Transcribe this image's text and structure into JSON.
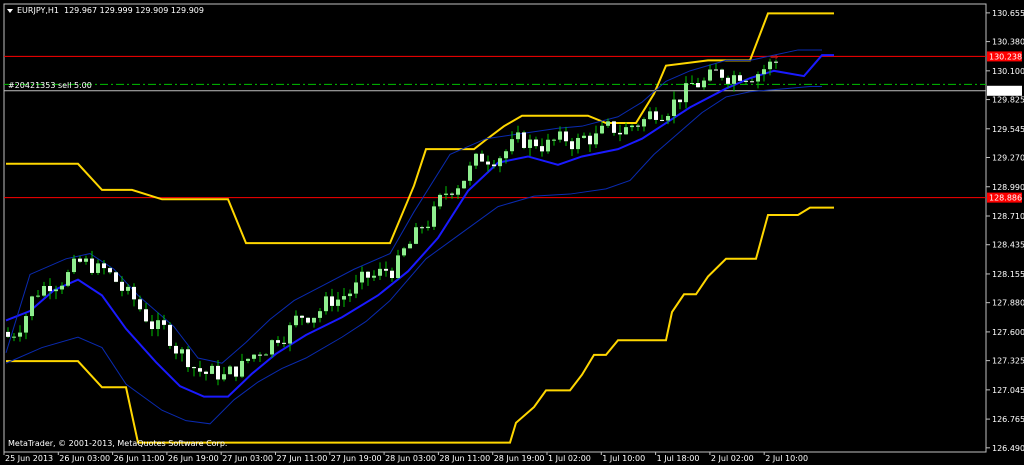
{
  "header": {
    "menu_icon": "triangle-down-icon",
    "symbol": "EURJPY,H1",
    "ohlc": "129.967 129.999 129.909 129.909"
  },
  "order_label": "#20421353 sell 5.00",
  "copyright": "MetaTrader, © 2001-2013, MetaQuotes Software Corp.",
  "price_tags": {
    "current": "129.909",
    "upper_line": "130.238",
    "lower_line": "128.886"
  },
  "colors": {
    "background": "#000000",
    "frame": "#c0c0c0",
    "bull_candle": "#90ee90",
    "bear_candle": "#ffffff",
    "wick": "#00c000",
    "outer_channel": "#ffd700",
    "mid_line": "#1a1aff",
    "inner_channel": "#0a2ab0",
    "horizontal_lines": "#ff0000",
    "order_line": "#00c000",
    "bid_line": "#c0c0c0"
  },
  "chart_data": {
    "type": "line",
    "symbol": "EURJPY",
    "timeframe": "H1",
    "ylim": [
      126.45,
      130.74
    ],
    "y_ticks": [
      "130.655",
      "130.380",
      "130.100",
      "129.825",
      "129.545",
      "129.270",
      "128.990",
      "128.710",
      "128.435",
      "128.155",
      "127.880",
      "127.600",
      "127.325",
      "127.045",
      "126.765",
      "126.490"
    ],
    "x_ticks": [
      "25 Jun 2013",
      "26 Jun 03:00",
      "26 Jun 11:00",
      "26 Jun 19:00",
      "27 Jun 03:00",
      "27 Jun 11:00",
      "27 Jun 19:00",
      "28 Jun 03:00",
      "28 Jun 11:00",
      "28 Jun 19:00",
      "1 Jul 02:00",
      "1 Jul 10:00",
      "1 Jul 18:00",
      "2 Jul 02:00",
      "2 Jul 10:00"
    ],
    "bar_count": 129,
    "horizontal_lines": [
      {
        "price": 130.238,
        "role": "upper red line"
      },
      {
        "price": 128.886,
        "role": "lower red line"
      },
      {
        "price": 129.97,
        "role": "order line"
      },
      {
        "price": 129.909,
        "role": "bid line"
      }
    ],
    "series": [
      {
        "role": "outer_channel_upper",
        "points": [
          [
            0,
            129.21
          ],
          [
            12,
            129.21
          ],
          [
            16,
            128.96
          ],
          [
            21,
            128.96
          ],
          [
            26,
            128.87
          ],
          [
            37,
            128.87
          ],
          [
            40,
            128.45
          ],
          [
            64,
            128.45
          ],
          [
            68,
            129.0
          ],
          [
            70,
            129.35
          ],
          [
            78,
            129.35
          ],
          [
            80,
            129.44
          ],
          [
            83,
            129.57
          ],
          [
            86,
            129.67
          ],
          [
            97,
            129.67
          ],
          [
            100,
            129.6
          ],
          [
            105,
            129.6
          ],
          [
            108,
            129.88
          ],
          [
            110,
            130.15
          ],
          [
            117,
            130.2
          ],
          [
            124,
            130.2
          ],
          [
            127,
            130.65
          ],
          [
            138,
            130.65
          ]
        ]
      },
      {
        "role": "outer_channel_lower",
        "points": [
          [
            0,
            127.32
          ],
          [
            12,
            127.32
          ],
          [
            16,
            127.07
          ],
          [
            20,
            127.07
          ],
          [
            22,
            126.54
          ],
          [
            84,
            126.54
          ],
          [
            85,
            126.73
          ],
          [
            88,
            126.88
          ],
          [
            90,
            127.04
          ],
          [
            94,
            127.04
          ],
          [
            96,
            127.19
          ],
          [
            98,
            127.38
          ],
          [
            100,
            127.38
          ],
          [
            102,
            127.52
          ],
          [
            110,
            127.52
          ],
          [
            111,
            127.79
          ],
          [
            113,
            127.96
          ],
          [
            115,
            127.96
          ],
          [
            117,
            128.13
          ],
          [
            120,
            128.3
          ],
          [
            125,
            128.3
          ],
          [
            127,
            128.72
          ],
          [
            132,
            128.72
          ],
          [
            134,
            128.79
          ],
          [
            138,
            128.79
          ]
        ]
      },
      {
        "role": "mid_line",
        "points": [
          [
            0,
            127.71
          ],
          [
            4,
            127.8
          ],
          [
            8,
            128.0
          ],
          [
            12,
            128.1
          ],
          [
            16,
            127.95
          ],
          [
            20,
            127.63
          ],
          [
            25,
            127.31
          ],
          [
            29,
            127.08
          ],
          [
            33,
            126.98
          ],
          [
            37,
            126.98
          ],
          [
            41,
            127.2
          ],
          [
            45,
            127.39
          ],
          [
            50,
            127.57
          ],
          [
            56,
            127.74
          ],
          [
            62,
            127.95
          ],
          [
            67,
            128.18
          ],
          [
            72,
            128.5
          ],
          [
            77,
            128.95
          ],
          [
            82,
            129.22
          ],
          [
            87,
            129.28
          ],
          [
            92,
            129.2
          ],
          [
            96,
            129.28
          ],
          [
            102,
            129.35
          ],
          [
            106,
            129.45
          ],
          [
            110,
            129.6
          ],
          [
            114,
            129.75
          ],
          [
            120,
            129.93
          ],
          [
            124,
            130.03
          ],
          [
            128,
            130.1
          ],
          [
            133,
            130.05
          ],
          [
            136,
            130.25
          ],
          [
            138,
            130.25
          ]
        ]
      },
      {
        "role": "inner_channel_upper",
        "points": [
          [
            0,
            127.4
          ],
          [
            4,
            128.15
          ],
          [
            10,
            128.3
          ],
          [
            14,
            128.35
          ],
          [
            18,
            128.2
          ],
          [
            22,
            127.95
          ],
          [
            28,
            127.65
          ],
          [
            32,
            127.35
          ],
          [
            36,
            127.3
          ],
          [
            40,
            127.5
          ],
          [
            44,
            127.72
          ],
          [
            48,
            127.9
          ],
          [
            53,
            128.05
          ],
          [
            58,
            128.2
          ],
          [
            64,
            128.35
          ],
          [
            68,
            128.75
          ],
          [
            74,
            129.3
          ],
          [
            80,
            129.45
          ],
          [
            86,
            129.5
          ],
          [
            92,
            129.55
          ],
          [
            96,
            129.57
          ],
          [
            102,
            129.66
          ],
          [
            106,
            129.8
          ],
          [
            110,
            130.0
          ],
          [
            114,
            130.1
          ],
          [
            120,
            130.2
          ],
          [
            124,
            130.2
          ],
          [
            128,
            130.25
          ],
          [
            132,
            130.3
          ],
          [
            136,
            130.3
          ]
        ]
      },
      {
        "role": "inner_channel_lower",
        "points": [
          [
            0,
            127.3
          ],
          [
            6,
            127.45
          ],
          [
            12,
            127.55
          ],
          [
            16,
            127.45
          ],
          [
            20,
            127.1
          ],
          [
            26,
            126.85
          ],
          [
            30,
            126.75
          ],
          [
            34,
            126.72
          ],
          [
            38,
            126.95
          ],
          [
            42,
            127.12
          ],
          [
            46,
            127.25
          ],
          [
            50,
            127.35
          ],
          [
            56,
            127.55
          ],
          [
            60,
            127.7
          ],
          [
            64,
            127.9
          ],
          [
            70,
            128.3
          ],
          [
            76,
            128.55
          ],
          [
            82,
            128.8
          ],
          [
            88,
            128.9
          ],
          [
            94,
            128.92
          ],
          [
            100,
            128.97
          ],
          [
            104,
            129.05
          ],
          [
            108,
            129.3
          ],
          [
            112,
            129.5
          ],
          [
            116,
            129.7
          ],
          [
            120,
            129.85
          ],
          [
            124,
            129.9
          ],
          [
            130,
            129.93
          ],
          [
            134,
            129.95
          ],
          [
            136,
            129.95
          ]
        ]
      }
    ]
  }
}
